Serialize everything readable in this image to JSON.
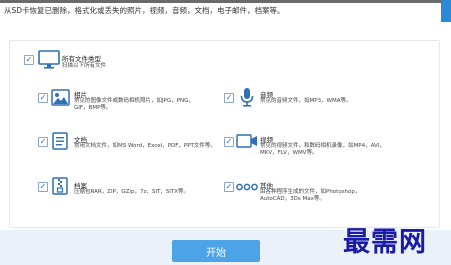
{
  "header": {
    "subtitle": "从SD卡恢复已删除，格式化或丢失的照片，视频，音频，文档，电子邮件，档案等。"
  },
  "all_types": {
    "title": "所有文件类型",
    "desc": "扫描以下所有文件",
    "checked": true
  },
  "categories": [
    {
      "title": "相片",
      "desc": "常见的图像文件或数码相机照片，如JPG，PNG，GIF，BMP等。",
      "checked": true,
      "icon": "photo-icon"
    },
    {
      "title": "音频",
      "desc": "常见的音频文件，如MP3，WMA等。",
      "checked": true,
      "icon": "microphone-icon"
    },
    {
      "title": "文档",
      "desc": "常用文档文件，如MS Word，Excel，PDF，PPT文件等。",
      "checked": true,
      "icon": "document-icon"
    },
    {
      "title": "视频",
      "desc": "常见的视频文件，和数码相机录像，如MP4，AVI，MKV，FLV，WMV等。",
      "checked": true,
      "icon": "video-icon"
    },
    {
      "title": "档案",
      "desc": "压缩包RAR，ZIP，GZip，7z，SIT，SITX等。",
      "checked": true,
      "icon": "archive-icon"
    },
    {
      "title": "其他",
      "desc": "由各种程序生成的文件，如Photoshop，AutoCAD，3Ds Max等。",
      "checked": true,
      "icon": "more-icon"
    }
  ],
  "footer": {
    "start_label": "开始"
  },
  "watermark": "最需网",
  "colors": {
    "accent": "#2e88d8",
    "button": "#4ca3e8",
    "icon": "#2e6fb6",
    "footer_bg": "#eaf1f8"
  }
}
